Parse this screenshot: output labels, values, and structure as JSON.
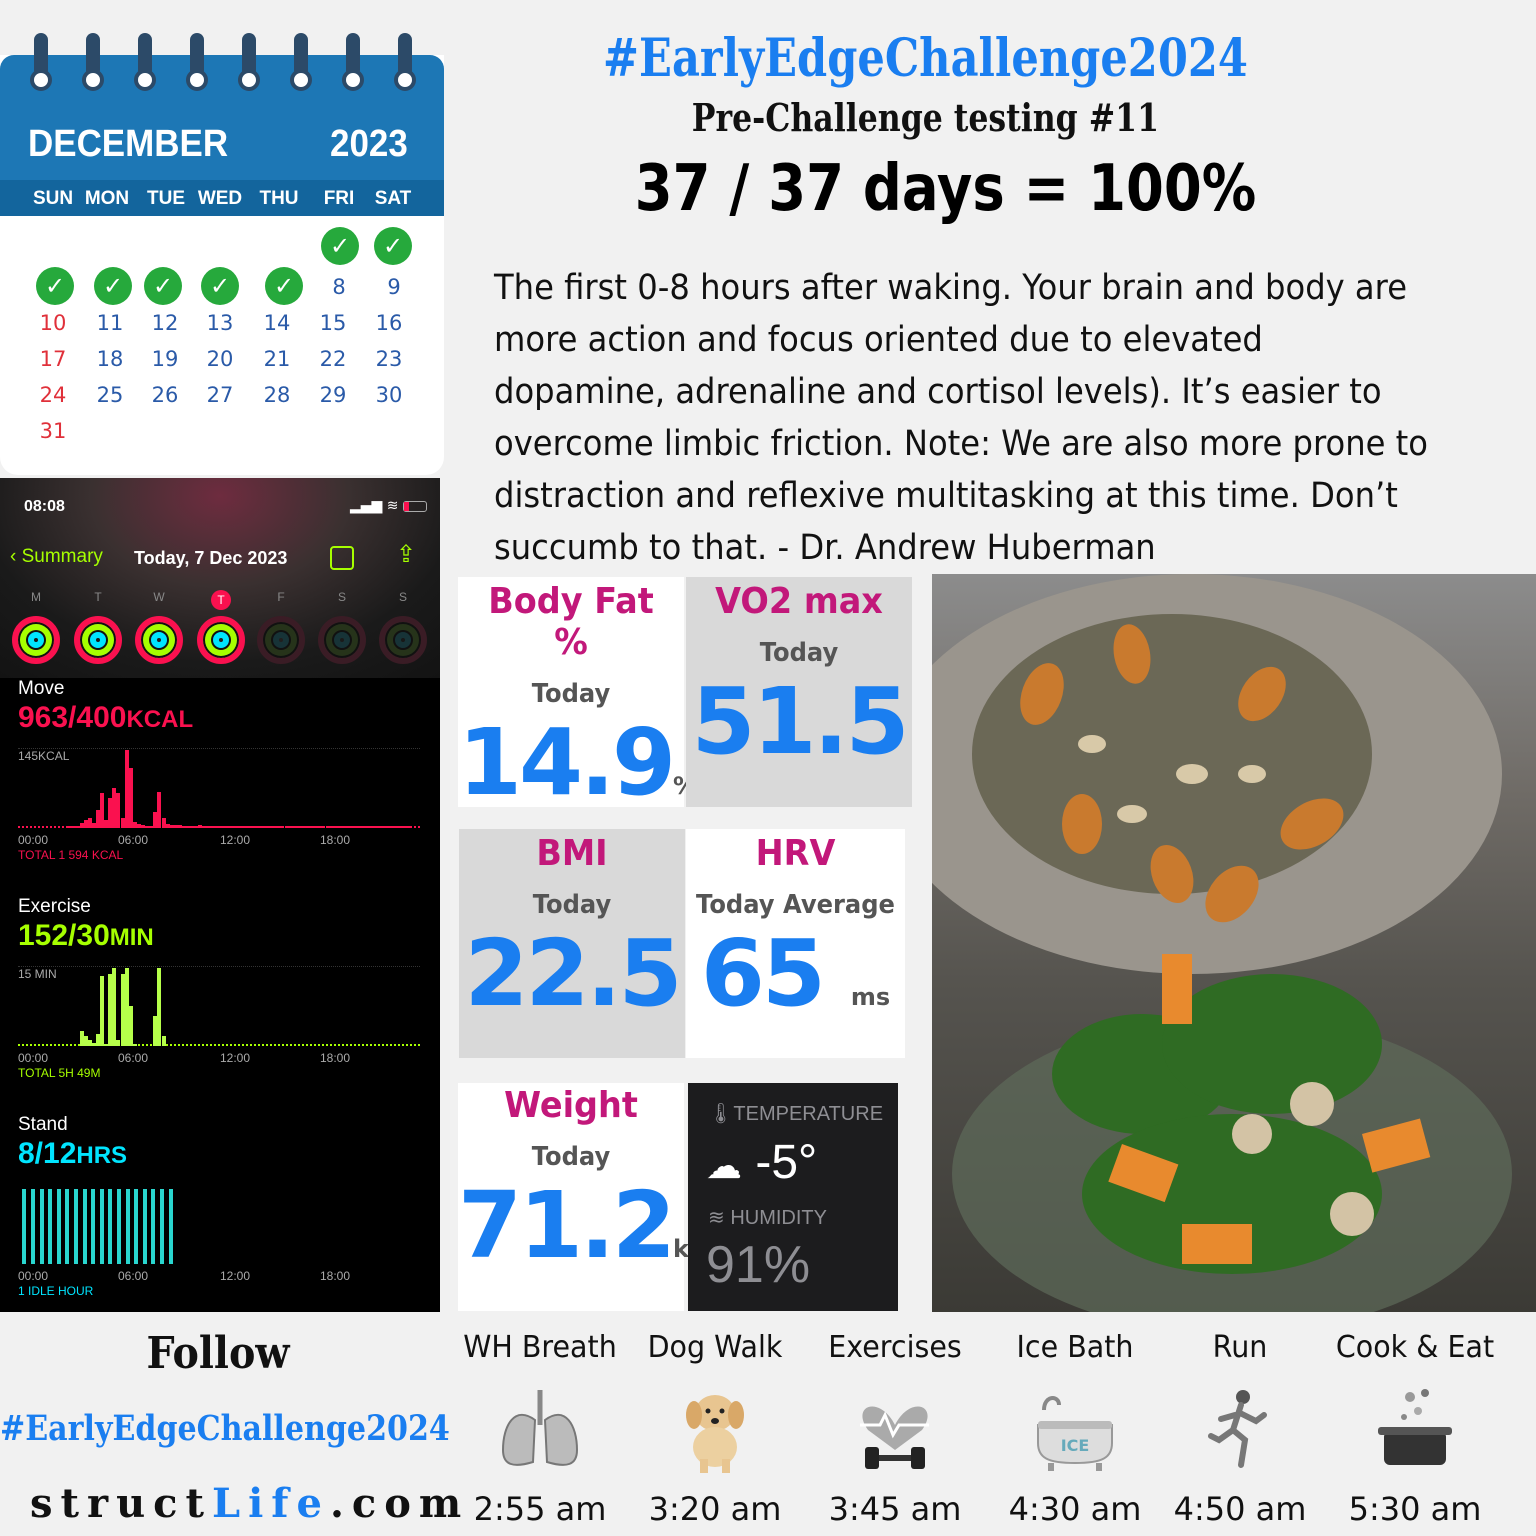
{
  "calendar": {
    "month": "DECEMBER",
    "year": "2023",
    "weekdays": [
      "SUN",
      "MON",
      "TUE",
      "WED",
      "THU",
      "FRI",
      "SAT"
    ],
    "rows": [
      [
        "8",
        "9"
      ],
      [
        "10",
        "11",
        "12",
        "13",
        "14",
        "15",
        "16"
      ],
      [
        "17",
        "18",
        "19",
        "20",
        "21",
        "22",
        "23"
      ],
      [
        "24",
        "25",
        "26",
        "27",
        "28",
        "29",
        "30"
      ],
      [
        "31"
      ]
    ],
    "r1": {
      "d8": "8",
      "d9": "9"
    },
    "r2": {
      "a": "10",
      "b": "11",
      "c": "12",
      "d": "13",
      "e": "14",
      "f": "15",
      "g": "16"
    },
    "r3": {
      "a": "17",
      "b": "18",
      "c": "19",
      "d": "20",
      "e": "21",
      "f": "22",
      "g": "23"
    },
    "r4": {
      "a": "24",
      "b": "25",
      "c": "26",
      "d": "27",
      "e": "28",
      "f": "29",
      "g": "30"
    },
    "r5": {
      "a": "31"
    },
    "checked_days_count": 7
  },
  "phone": {
    "time": "08:08",
    "back_label": "Summary",
    "date": "Today, 7 Dec 2023",
    "week": [
      "M",
      "T",
      "W",
      "T",
      "F",
      "S",
      "S"
    ],
    "move": {
      "label": "Move",
      "value": "963/400",
      "unit": "KCAL",
      "ymax": "145KCAL",
      "total": "TOTAL 1 594 KCAL",
      "color": "#fa114f"
    },
    "exercise": {
      "label": "Exercise",
      "value": "152/30",
      "unit": "MIN",
      "ymax": "15 MIN",
      "total": "TOTAL 5H 49M",
      "color": "#a6ff00"
    },
    "stand": {
      "label": "Stand",
      "value": "8/12",
      "unit": "HRS",
      "total": "1 IDLE HOUR",
      "color": "#00e5ff"
    },
    "ticks": [
      "00:00",
      "06:00",
      "12:00",
      "18:00"
    ]
  },
  "header": {
    "hashtag": "#EarlyEdgeChallenge2024",
    "subtitle": "Pre-Challenge testing #11",
    "days": "37 / 37 days = 100%"
  },
  "quote": "The first 0-8 hours after waking. Your brain and body are more action and focus oriented due to elevated dopamine, adrenaline and cortisol levels). It’s easier to overcome limbic friction. Note: We are also more prone to distraction and reflexive multitasking at this time. Don’t succumb to that. - Dr. Andrew Huberman",
  "metrics": {
    "bodyfat": {
      "title": "Body Fat %",
      "sub": "Today",
      "value": "14.9",
      "unit": "%"
    },
    "vo2": {
      "title": "VO2 max",
      "sub": "Today",
      "value": "51.5"
    },
    "bmi": {
      "title": "BMI",
      "sub": "Today",
      "value": "22.5"
    },
    "hrv": {
      "title": "HRV",
      "sub": "Today Average",
      "value": "65",
      "unit": "ms"
    },
    "weight": {
      "title": "Weight",
      "sub": "Today",
      "value": "71.2",
      "unit": "kg"
    }
  },
  "weather": {
    "temp_label": "TEMPERATURE",
    "temp": "-5°",
    "hum_label": "HUMIDITY",
    "hum": "91%"
  },
  "follow": {
    "label": "Follow",
    "hashtag": "#EarlyEdgeChallenge2024",
    "site_a": "struct",
    "site_b": "Life",
    ".com": ".com",
    "site_c": ".com"
  },
  "activities": [
    {
      "name": "WH Breath",
      "time": "2:55 am",
      "icon": "lungs-icon"
    },
    {
      "name": "Dog Walk",
      "time": "3:20 am",
      "icon": "puppy-icon"
    },
    {
      "name": "Exercises",
      "time": "3:45 am",
      "icon": "dumbbell-heart-icon"
    },
    {
      "name": "Ice Bath",
      "time": "4:30 am",
      "icon": "ice-bath-icon"
    },
    {
      "name": "Run",
      "time": "4:50 am",
      "icon": "runner-icon"
    },
    {
      "name": "Cook & Eat",
      "time": "5:30 am",
      "icon": "cooking-pot-icon"
    }
  ]
}
